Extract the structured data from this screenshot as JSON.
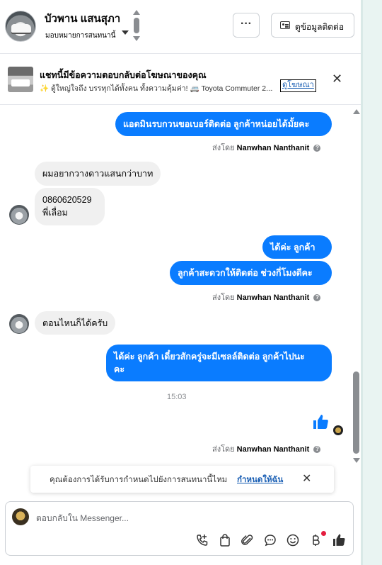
{
  "header": {
    "name": "บัวพาน แสนสุภา",
    "assign_label": "มอบหมายการสนทนานี้",
    "more_label": "···",
    "contact_button": "ดูข้อมูลติดต่อ"
  },
  "ad": {
    "title": "แชทนี้มีข้อความตอบกลับต่อโฆษณาของคุณ",
    "subtitle": "✨ ตู้ใหญ่ใจถึง บรรทุกได้ทั้งคน ทั้งความคุ้มค่า! 🚐 Toyota Commuter 2....",
    "view_ad": "ดูโฆษณา",
    "close": "✕"
  },
  "messages": [
    {
      "id": "m1",
      "direction": "out",
      "text": "แอดมินรบกวนขอเบอร์ติดต่อ ลูกค้าหน่อยได้มั้ยคะ"
    },
    {
      "id": "m2",
      "direction": "in",
      "text": "ผมอยากวางดาวแสนกว่าบาท"
    },
    {
      "id": "m3",
      "direction": "in",
      "text": "0860620529\nพี่เลื่อม"
    },
    {
      "id": "m4",
      "direction": "out",
      "text": "ได้ค่ะ  ลูกค้า"
    },
    {
      "id": "m5",
      "direction": "out",
      "text": "ลูกค้าสะดวกให้ติดต่อ ช่วงกี่โมงดีคะ"
    },
    {
      "id": "m6",
      "direction": "in",
      "text": "ตอนไหนก็ได้ครับ"
    },
    {
      "id": "m7",
      "direction": "out",
      "text": "ได้ค่ะ  ลูกค้า  เดี๋ยวสักครู่จะมีเซลล์ติดต่อ ลูกค้าไปนะ\nคะ"
    }
  ],
  "sent_by": {
    "prefix": "ส่งโดย",
    "sender": "Nanwhan Nanthanit",
    "info": "?"
  },
  "timestamp": "15:03",
  "reminder": {
    "text": "คุณต้องการได้รับการกำหนดไปยังการสนทนานี้ไหม",
    "action": "กำหนดให้ฉัน",
    "close": "✕"
  },
  "composer": {
    "placeholder": "ตอบกลับใน Messenger..."
  },
  "colors": {
    "outgoing_bubble": "#0a7cff",
    "incoming_bubble": "#f0f0f0",
    "link": "#1a5fb4",
    "notification_dot": "#e41e3f"
  },
  "icons": {
    "tools": [
      "phone-plus-icon",
      "shopping-bag-icon",
      "paperclip-icon",
      "chat-bubble-icon",
      "smiley-icon",
      "baht-icon",
      "thumbs-up-icon"
    ]
  }
}
